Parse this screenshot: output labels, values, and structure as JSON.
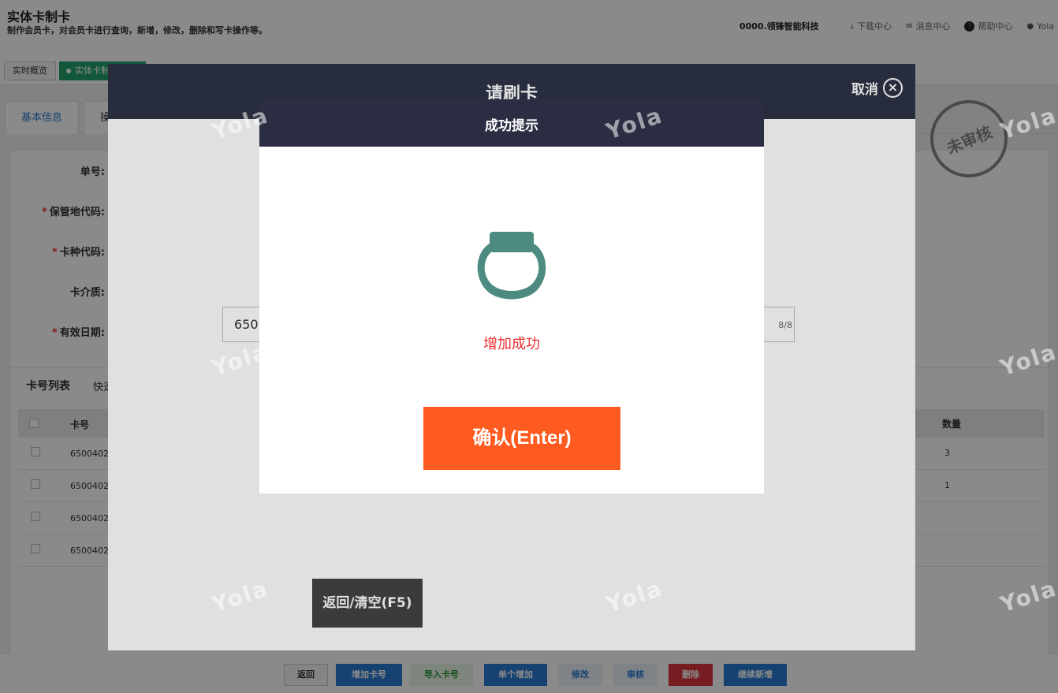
{
  "header": {
    "title": "实体卡制卡",
    "subtitle": "制作会员卡，对会员卡进行查询，新增，修改，删除和写卡操作等。",
    "company": "0000.领锋智能科技",
    "links": {
      "download": "下载中心",
      "messages": "消息中心",
      "help": "帮助中心",
      "user": "Yola"
    },
    "icons": {
      "download": "download-icon",
      "messages": "mail-icon",
      "help": "help-icon",
      "user": "user-icon"
    }
  },
  "tabs": {
    "overview": "实时概览",
    "active": "实体卡制卡"
  },
  "form": {
    "tabs": [
      "基本信息",
      "操"
    ],
    "labels": [
      {
        "text": "单号:",
        "required": false
      },
      {
        "text": "保管地代码:",
        "required": true
      },
      {
        "text": "卡种代码:",
        "required": true
      },
      {
        "text": "卡介质:",
        "required": false
      },
      {
        "text": "有效日期:",
        "required": true
      }
    ]
  },
  "list": {
    "title": "卡号列表",
    "quick": "快速",
    "columns": {
      "card": "卡号",
      "qty": "数量"
    },
    "rows": [
      {
        "card": "6500402",
        "qty": "3"
      },
      {
        "card": "6500402",
        "qty": "1"
      },
      {
        "card": "6500402",
        "qty": ""
      },
      {
        "card": "6500402",
        "qty": ""
      }
    ]
  },
  "seal": "未审核",
  "watermark": "Yola",
  "bottom_buttons": [
    {
      "label": "返回",
      "color": "#333333",
      "bg": "#f5f5f5"
    },
    {
      "label": "增加卡号",
      "color": "#ffffff",
      "bg": "#2a7bd1"
    },
    {
      "label": "导入卡号",
      "color": "#2e9a3c",
      "bg": "#e9f6e6"
    },
    {
      "label": "单个增加",
      "color": "#ffffff",
      "bg": "#2a7bd1"
    },
    {
      "label": "修改",
      "color": "#2a7bd1",
      "bg": "#eaf2fb"
    },
    {
      "label": "审核",
      "color": "#2a7bd1",
      "bg": "#eaf2fb"
    },
    {
      "label": "删除",
      "color": "#ffffff",
      "bg": "#d9363e"
    },
    {
      "label": "继续新增",
      "color": "#ffffff",
      "bg": "#2a7bd1"
    }
  ],
  "swipe_modal": {
    "title": "请刷卡",
    "cancel": "取消",
    "input_value": "650",
    "input_count": "8/8",
    "back_button": "返回/清空(F5)"
  },
  "success_modal": {
    "title": "成功提示",
    "message": "增加成功",
    "confirm": "确认(Enter)",
    "icon": "ring-icon",
    "accent": "#4d8b80"
  }
}
